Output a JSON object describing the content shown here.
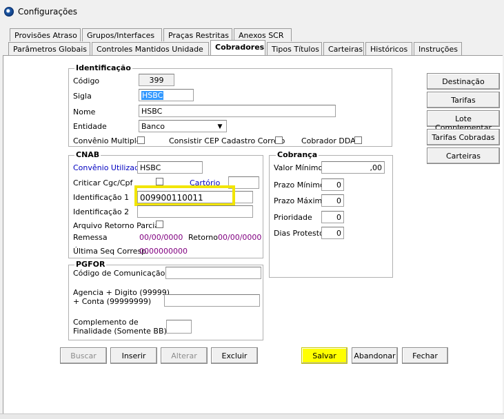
{
  "window": {
    "title": "Configurações"
  },
  "tabs_row1": [
    "Provisões Atraso",
    "Grupos/Interfaces",
    "Praças Restritas",
    "Anexos SCR"
  ],
  "tabs_row2": [
    "Parâmetros Globais",
    "Controles Mantidos Unidade",
    "Cobradores",
    "Tipos Títulos",
    "Carteiras",
    "Históricos",
    "Instruções"
  ],
  "active_tab": "Cobradores",
  "identificacao": {
    "legend": "Identificação",
    "codigo_label": "Código",
    "codigo_value": "399",
    "sigla_label": "Sigla",
    "sigla_value": "HSBC",
    "nome_label": "Nome",
    "nome_value": "HSBC",
    "entidade_label": "Entidade",
    "entidade_value": "Banco",
    "convenio_multiplo_label": "Convênio Multiplo",
    "consistir_cep_label": "Consistir CEP Cadastro Correio",
    "cobrador_dda_label": "Cobrador DDA"
  },
  "cnab": {
    "legend": "CNAB",
    "convenio_utilizado_label": "Convênio Utilizado",
    "convenio_utilizado_value": "HSBC",
    "criticar_label": "Criticar Cgc/Cpf",
    "cartorio_label": "Cartório",
    "cartorio_value": "",
    "identificacao1_label": "Identificação 1",
    "identificacao1_value": "009900110011",
    "identificacao2_label": "Identificação 2",
    "identificacao2_value": "",
    "arquivo_retorno_label": "Arquivo Retorno Parcial",
    "remessa_label": "Remessa",
    "remessa_value": "00/00/0000",
    "retorno_label": "Retorno",
    "retorno_value": "00/00/0000",
    "ultima_seq_label": "Última Seq Corresp.",
    "ultima_seq_value": "0000000000"
  },
  "cobranca": {
    "legend": "Cobrança",
    "valor_minimo_label": "Valor Mínimo",
    "valor_minimo_value": ",00",
    "prazo_minimo_label": "Prazo Mínimo",
    "prazo_minimo_value": "0",
    "prazo_maximo_label": "Prazo Máximo",
    "prazo_maximo_value": "0",
    "prioridade_label": "Prioridade",
    "prioridade_value": "0",
    "dias_protesto_label": "Dias Protesto",
    "dias_protesto_value": "0"
  },
  "pgfor": {
    "legend": "PGFOR",
    "codigo_comunicacao_label": "Código de Comunicação",
    "codigo_comunicacao_value": "",
    "agencia_label_line1": "Agencia + Digito (99999)",
    "agencia_label_line2": "+ Conta (99999999)",
    "agencia_value": "",
    "complemento_label_line1": "Complemento de",
    "complemento_label_line2": "Finalidade (Somente BB)",
    "complemento_value": ""
  },
  "side_buttons": [
    "Destinação",
    "Tarifas",
    "Lote Complementar",
    "Tarifas Cobradas",
    "Carteiras"
  ],
  "bottom_buttons": {
    "buscar": "Buscar",
    "inserir": "Inserir",
    "alterar": "Alterar",
    "excluir": "Excluir",
    "salvar": "Salvar",
    "abandonar": "Abandonar",
    "fechar": "Fechar"
  },
  "colors": {
    "highlight_yellow": "#ffff00",
    "link_blue": "#0000c0",
    "date_purple": "#800080"
  }
}
